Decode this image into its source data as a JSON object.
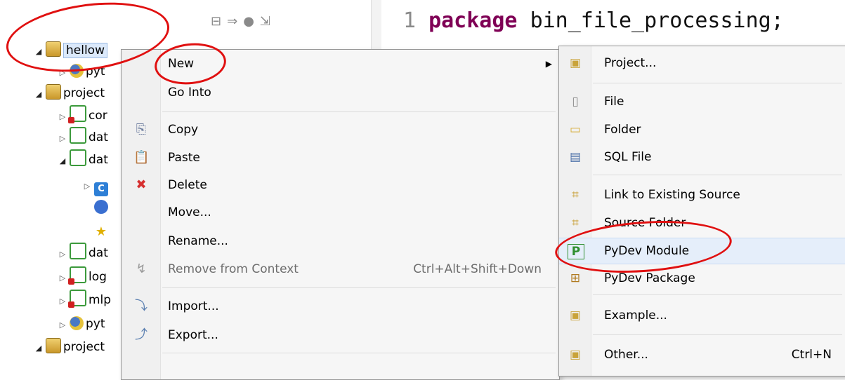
{
  "explorer": {
    "items": [
      {
        "label": "hellow",
        "icon": "project-icon",
        "twisty": "expanded"
      },
      {
        "label": "pyt",
        "icon": "python-icon",
        "twisty": "collapsed"
      },
      {
        "label": "project",
        "icon": "project-icon",
        "twisty": "expanded"
      },
      {
        "label": "cor",
        "icon": "pydev-package-error-icon",
        "twisty": "collapsed"
      },
      {
        "label": "dat",
        "icon": "pydev-package-icon",
        "twisty": "collapsed"
      },
      {
        "label": "dat",
        "icon": "pydev-package-icon",
        "twisty": "expanded"
      },
      {
        "label": "C",
        "icon": "class-icon",
        "twisty": "collapsed"
      },
      {
        "label": "",
        "icon": "module-icon",
        "twisty": "none"
      },
      {
        "label": "",
        "icon": "star-icon",
        "twisty": "none"
      },
      {
        "label": "dat",
        "icon": "pydev-package-icon",
        "twisty": "collapsed"
      },
      {
        "label": "log",
        "icon": "pydev-package-error-icon",
        "twisty": "collapsed"
      },
      {
        "label": "mlp",
        "icon": "pydev-package-error-icon",
        "twisty": "collapsed"
      },
      {
        "label": "pyt",
        "icon": "python-icon",
        "twisty": "collapsed"
      },
      {
        "label": "project",
        "icon": "project-icon",
        "twisty": "expanded"
      }
    ]
  },
  "editor": {
    "line_number": "1",
    "keyword": "package",
    "code": "bin_file_processing;"
  },
  "context_menu": {
    "items": [
      {
        "label": "New",
        "icon": "",
        "shortcut": "",
        "submenu": true,
        "disabled": false
      },
      {
        "label": "Go Into",
        "icon": "",
        "shortcut": "",
        "submenu": false,
        "disabled": false
      },
      {
        "label": "Copy",
        "icon": "copy-icon",
        "shortcut": "",
        "submenu": false,
        "disabled": false
      },
      {
        "label": "Paste",
        "icon": "paste-icon",
        "shortcut": "",
        "submenu": false,
        "disabled": false
      },
      {
        "label": "Delete",
        "icon": "delete-icon",
        "shortcut": "",
        "submenu": false,
        "disabled": false
      },
      {
        "label": "Move...",
        "icon": "",
        "shortcut": "",
        "submenu": false,
        "disabled": false
      },
      {
        "label": "Rename...",
        "icon": "",
        "shortcut": "",
        "submenu": false,
        "disabled": false
      },
      {
        "label": "Remove from Context",
        "icon": "remove-context-icon",
        "shortcut": "Ctrl+Alt+Shift+Down",
        "submenu": false,
        "disabled": true
      },
      {
        "label": "Import...",
        "icon": "import-icon",
        "shortcut": "",
        "submenu": false,
        "disabled": false
      },
      {
        "label": "Export...",
        "icon": "export-icon",
        "shortcut": "",
        "submenu": false,
        "disabled": false
      }
    ]
  },
  "new_submenu": {
    "items": [
      {
        "label": "Project...",
        "icon": "project-wizard-icon",
        "shortcut": ""
      },
      {
        "label": "File",
        "icon": "file-icon",
        "shortcut": ""
      },
      {
        "label": "Folder",
        "icon": "folder-icon",
        "shortcut": ""
      },
      {
        "label": "SQL File",
        "icon": "sql-file-icon",
        "shortcut": ""
      },
      {
        "label": "Link to Existing Source",
        "icon": "link-source-icon",
        "shortcut": ""
      },
      {
        "label": "Source Folder",
        "icon": "source-folder-icon",
        "shortcut": ""
      },
      {
        "label": "PyDev Module",
        "icon": "pydev-module-icon",
        "shortcut": ""
      },
      {
        "label": "PyDev Package",
        "icon": "pydev-package-icon",
        "shortcut": ""
      },
      {
        "label": "Example...",
        "icon": "example-icon",
        "shortcut": ""
      },
      {
        "label": "Other...",
        "icon": "other-icon",
        "shortcut": "Ctrl+N"
      }
    ]
  },
  "annotation_color": "#e01010"
}
